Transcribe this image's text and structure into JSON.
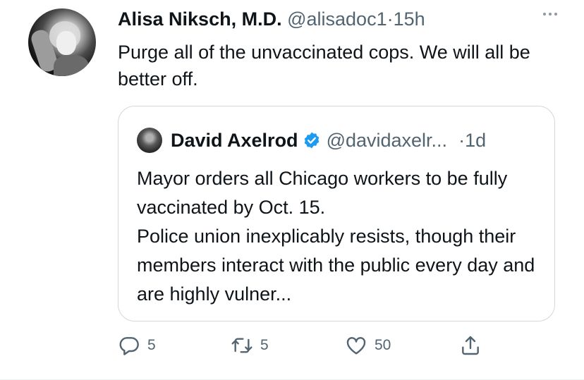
{
  "tweet": {
    "author_name": "Alisa Niksch, M.D.",
    "author_handle": "@alisadoc1",
    "separator": "·",
    "time": "15h",
    "text": "Purge all of the unvaccinated cops. We will all be better off."
  },
  "quoted_tweet": {
    "author_name": "David Axelrod",
    "author_handle": "@davidaxelr...",
    "separator": "·",
    "time": "1d",
    "text": "Mayor orders all Chicago workers to be fully vaccinated by Oct. 15.\nPolice union inexplicably resists, though their members interact with the public every day and are highly vulner..."
  },
  "actions": {
    "replies": "5",
    "retweets": "5",
    "likes": "50"
  },
  "colors": {
    "text": "#0f1419",
    "muted": "#536471",
    "verified": "#1d9bf0",
    "border": "#cfd9de"
  },
  "icons": [
    "reply-icon",
    "retweet-icon",
    "like-icon",
    "share-icon",
    "verified-icon",
    "more-icon"
  ]
}
